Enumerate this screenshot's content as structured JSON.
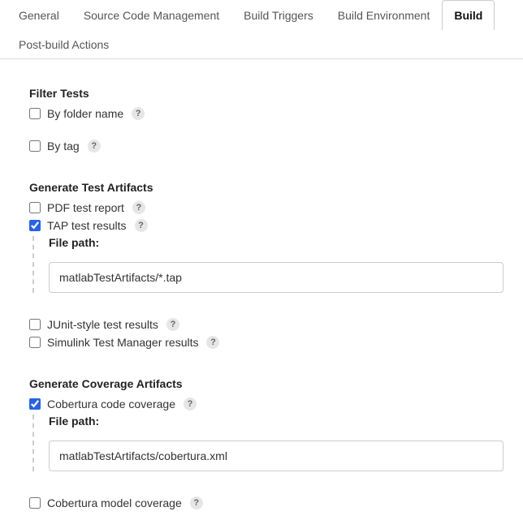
{
  "tabs": [
    {
      "label": "General"
    },
    {
      "label": "Source Code Management"
    },
    {
      "label": "Build Triggers"
    },
    {
      "label": "Build Environment"
    },
    {
      "label": "Build"
    },
    {
      "label": "Post-build Actions"
    }
  ],
  "sections": {
    "filter": {
      "title": "Filter Tests",
      "by_folder": "By folder name",
      "by_tag": "By tag"
    },
    "artifacts": {
      "title": "Generate Test Artifacts",
      "pdf": "PDF test report",
      "tap": "TAP test results",
      "tap_path_label": "File path:",
      "tap_path_value": "matlabTestArtifacts/*.tap",
      "junit": "JUnit-style test results",
      "simulink": "Simulink Test Manager results"
    },
    "coverage": {
      "title": "Generate Coverage Artifacts",
      "cobertura": "Cobertura code coverage",
      "cobertura_path_label": "File path:",
      "cobertura_path_value": "matlabTestArtifacts/cobertura.xml",
      "model": "Cobertura model coverage"
    }
  },
  "help_char": "?"
}
